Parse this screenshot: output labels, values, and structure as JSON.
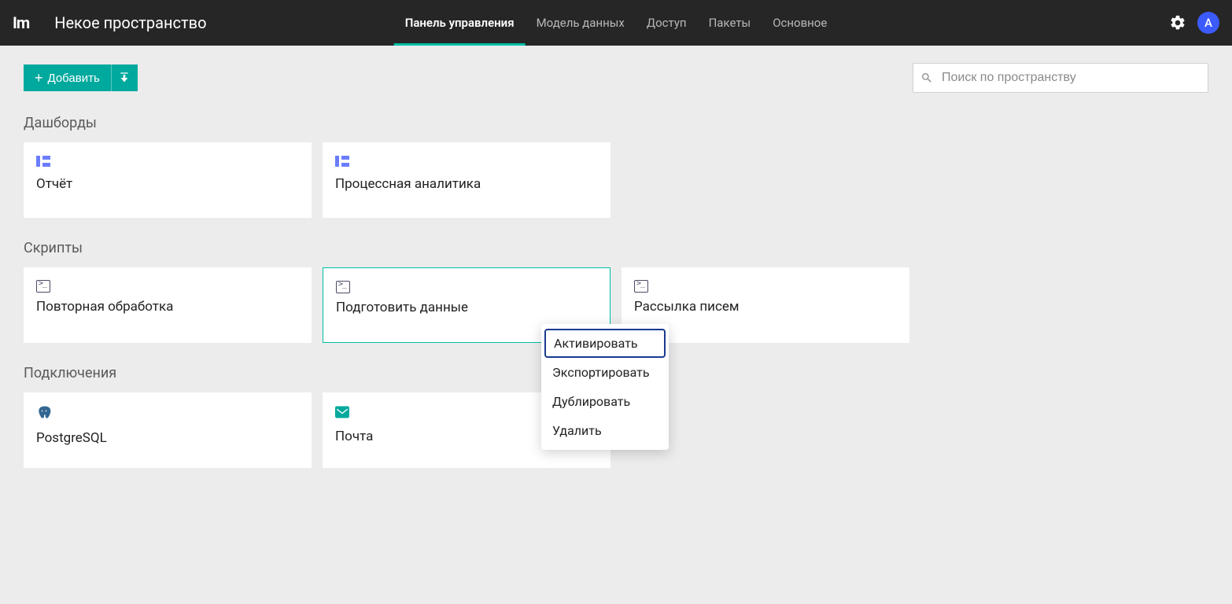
{
  "header": {
    "logo": "Im",
    "workspace_name": "Некое пространство",
    "avatar_letter": "A"
  },
  "nav": {
    "items": [
      {
        "label": "Панель управления",
        "active": true
      },
      {
        "label": "Модель данных",
        "active": false
      },
      {
        "label": "Доступ",
        "active": false
      },
      {
        "label": "Пакеты",
        "active": false
      },
      {
        "label": "Основное",
        "active": false
      }
    ]
  },
  "toolbar": {
    "add_label": "Добавить"
  },
  "search": {
    "placeholder": "Поиск по пространству"
  },
  "sections": {
    "dashboards": {
      "title": "Дашборды",
      "cards": [
        {
          "title": "Отчёт"
        },
        {
          "title": "Процессная аналитика"
        }
      ]
    },
    "scripts": {
      "title": "Скрипты",
      "cards": [
        {
          "title": "Повторная обработка"
        },
        {
          "title": "Подготовить данные"
        },
        {
          "title": "Рассылка писем"
        }
      ]
    },
    "connections": {
      "title": "Подключения",
      "cards": [
        {
          "title": "PostgreSQL"
        },
        {
          "title": "Почта"
        }
      ]
    }
  },
  "context_menu": {
    "items": [
      {
        "label": "Активировать",
        "highlighted": true
      },
      {
        "label": "Экспортировать",
        "highlighted": false
      },
      {
        "label": "Дублировать",
        "highlighted": false
      },
      {
        "label": "Удалить",
        "highlighted": false
      }
    ]
  }
}
